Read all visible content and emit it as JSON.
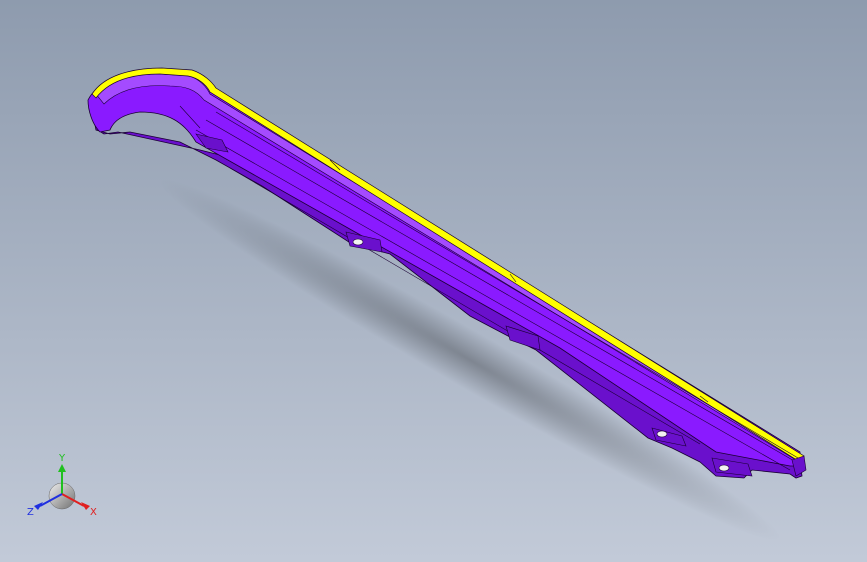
{
  "viewport": {
    "background_top": "#8e9bae",
    "background_bottom": "#c2cad8"
  },
  "part": {
    "body_color": "#8a1aff",
    "body_shade": "#6a10cc",
    "body_light": "#a44bff",
    "edge_color": "#ffff00",
    "outline_color": "#1a0033"
  },
  "triad": {
    "x_label": "X",
    "y_label": "Y",
    "z_label": "Z",
    "x_color": "#e02020",
    "y_color": "#20c020",
    "z_color": "#2030e0"
  }
}
